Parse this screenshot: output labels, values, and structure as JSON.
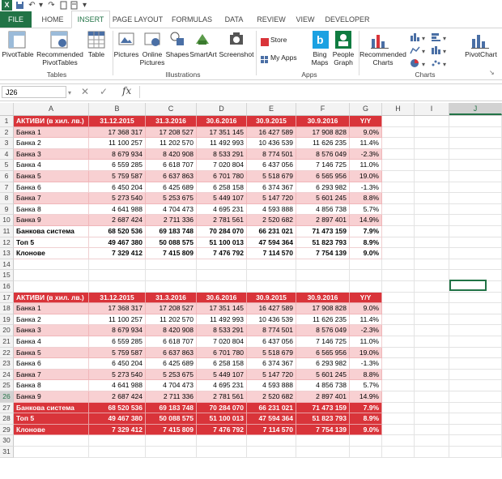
{
  "ribbon_tabs": [
    "FILE",
    "HOME",
    "INSERT",
    "PAGE LAYOUT",
    "FORMULAS",
    "DATA",
    "REVIEW",
    "VIEW",
    "DEVELOPER"
  ],
  "ribbon": {
    "pivottable": "PivotTable",
    "recommended_pivottables": "Recommended PivotTables",
    "table": "Table",
    "group_tables": "Tables",
    "pictures": "Pictures",
    "online_pictures": "Online Pictures",
    "shapes": "Shapes",
    "smartart": "SmartArt",
    "screenshot": "Screenshot",
    "group_illustrations": "Illustrations",
    "store": "Store",
    "my_apps": "My Apps",
    "bing_maps": "Bing Maps",
    "people_graph": "People Graph",
    "group_apps": "Apps",
    "recommended_charts": "Recommended Charts",
    "pivotchart": "PivotChart",
    "group_charts": "Charts"
  },
  "formula_bar": {
    "name_box": "J26",
    "fx": "fx",
    "formula": ""
  },
  "columns": [
    "A",
    "B",
    "C",
    "D",
    "E",
    "F",
    "G",
    "H",
    "I",
    "J"
  ],
  "table1": {
    "header": [
      "АКТИВИ (в хил. лв.)",
      "31.12.2015",
      "31.3.2016",
      "30.6.2016",
      "30.9.2015",
      "30.9.2016",
      "Y/Y"
    ],
    "banks": [
      [
        "Банка 1",
        "17 368 317",
        "17 208 527",
        "17 351 145",
        "16 427 589",
        "17 908 828",
        "9.0%"
      ],
      [
        "Банка 2",
        "11 100 257",
        "11 202 570",
        "11 492 993",
        "10 436 539",
        "11 626 235",
        "11.4%"
      ],
      [
        "Банка 3",
        "8 679 934",
        "8 420 908",
        "8 533 291",
        "8 774 501",
        "8 576 049",
        "-2.3%"
      ],
      [
        "Банка 4",
        "6 559 285",
        "6 618 707",
        "7 020 804",
        "6 437 056",
        "7 146 725",
        "11.0%"
      ],
      [
        "Банка 5",
        "5 759 587",
        "6 637 863",
        "6 701 780",
        "5 518 679",
        "6 565 956",
        "19.0%"
      ],
      [
        "Банка 6",
        "6 450 204",
        "6 425 689",
        "6 258 158",
        "6 374 367",
        "6 293 982",
        "-1.3%"
      ],
      [
        "Банка 7",
        "5 273 540",
        "5 253 675",
        "5 449 107",
        "5 147 720",
        "5 601 245",
        "8.8%"
      ],
      [
        "Банка 8",
        "4 641 988",
        "4 704 473",
        "4 695 231",
        "4 593 888",
        "4 856 738",
        "5.7%"
      ],
      [
        "Банка 9",
        "2 687 424",
        "2 711 336",
        "2 781 561",
        "2 520 682",
        "2 897 401",
        "14.9%"
      ]
    ],
    "totals": [
      [
        "Банкова система",
        "68 520 536",
        "69 183 748",
        "70 284 070",
        "66 231 021",
        "71 473 159",
        "7.9%"
      ],
      [
        "Топ 5",
        "49 467 380",
        "50 088 575",
        "51 100 013",
        "47 594 364",
        "51 823 793",
        "8.9%"
      ],
      [
        "Клонове",
        "7 329 412",
        "7 415 809",
        "7 476 792",
        "7 114 570",
        "7 754 139",
        "9.0%"
      ]
    ]
  },
  "table2": {
    "header": [
      "АКТИВИ (в хил. лв.)",
      "31.12.2015",
      "31.3.2016",
      "30.6.2016",
      "30.9.2015",
      "30.9.2016",
      "Y/Y"
    ],
    "banks": [
      [
        "Банка 1",
        "17 368 317",
        "17 208 527",
        "17 351 145",
        "16 427 589",
        "17 908 828",
        "9.0%"
      ],
      [
        "Банка 2",
        "11 100 257",
        "11 202 570",
        "11 492 993",
        "10 436 539",
        "11 626 235",
        "11.4%"
      ],
      [
        "Банка 3",
        "8 679 934",
        "8 420 908",
        "8 533 291",
        "8 774 501",
        "8 576 049",
        "-2.3%"
      ],
      [
        "Банка 4",
        "6 559 285",
        "6 618 707",
        "7 020 804",
        "6 437 056",
        "7 146 725",
        "11.0%"
      ],
      [
        "Банка 5",
        "5 759 587",
        "6 637 863",
        "6 701 780",
        "5 518 679",
        "6 565 956",
        "19.0%"
      ],
      [
        "Банка 6",
        "6 450 204",
        "6 425 689",
        "6 258 158",
        "6 374 367",
        "6 293 982",
        "-1.3%"
      ],
      [
        "Банка 7",
        "5 273 540",
        "5 253 675",
        "5 449 107",
        "5 147 720",
        "5 601 245",
        "8.8%"
      ],
      [
        "Банка 8",
        "4 641 988",
        "4 704 473",
        "4 695 231",
        "4 593 888",
        "4 856 738",
        "5.7%"
      ],
      [
        "Банка 9",
        "2 687 424",
        "2 711 336",
        "2 781 561",
        "2 520 682",
        "2 897 401",
        "14.9%"
      ]
    ],
    "totals": [
      [
        "Банкова система",
        "68 520 536",
        "69 183 748",
        "70 284 070",
        "66 231 021",
        "71 473 159",
        "7.9%"
      ],
      [
        "Топ 5",
        "49 467 380",
        "50 088 575",
        "51 100 013",
        "47 594 364",
        "51 823 793",
        "8.9%"
      ],
      [
        "Клонове",
        "7 329 412",
        "7 415 809",
        "7 476 792",
        "7 114 570",
        "7 754 139",
        "9.0%"
      ]
    ]
  },
  "row_numbers": [
    "1",
    "2",
    "3",
    "4",
    "5",
    "6",
    "7",
    "8",
    "9",
    "10",
    "11",
    "12",
    "13",
    "14",
    "15",
    "16",
    "17",
    "18",
    "19",
    "20",
    "21",
    "22",
    "23",
    "24",
    "25",
    "26",
    "27",
    "28",
    "29",
    "30",
    "31"
  ],
  "selected_cell": "J26",
  "accent_red": "#d9343a",
  "accent_pink": "#f8d0d2",
  "accent_green": "#217346"
}
